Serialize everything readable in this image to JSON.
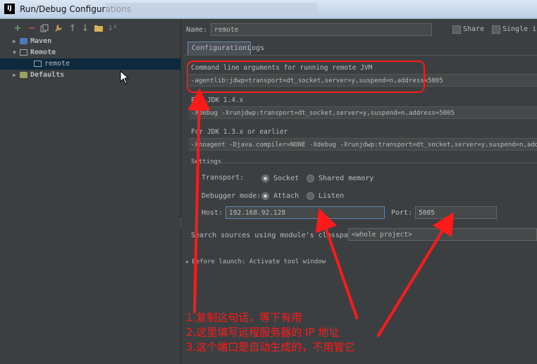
{
  "window": {
    "title": "Run/Debug Configurations",
    "app_icon_text": "IJ"
  },
  "tree": {
    "items": [
      {
        "label": "Maven",
        "expanded": false
      },
      {
        "label": "Remote",
        "expanded": true
      },
      {
        "label": "remote",
        "selected": true
      },
      {
        "label": "Defaults",
        "expanded": false
      }
    ]
  },
  "form": {
    "name_label": "Name:",
    "name_value": "remote",
    "share_label": "Share",
    "single_instance_label": "Single in",
    "tabs": [
      {
        "label": "Configuration",
        "active": true
      },
      {
        "label": "Logs",
        "active": false
      }
    ],
    "cmd_label": "Command line arguments for running remote JVM",
    "cmd_value": "-agentlib:jdwp=transport=dt_socket,server=y,suspend=n,address=5005",
    "jdk14_label": "For JDK 1.4.x",
    "jdk14_value": "-Xdebug -Xrunjdwp:transport=dt_socket,server=y,suspend=n,address=5005",
    "jdk13_label": "For JDK 1.3.x or earlier",
    "jdk13_value": "-Xnoagent -Djava.compiler=NONE -Xdebug -Xrunjdwp:transport=dt_socket,server=y,suspend=n,address=5005",
    "settings_label": "Settings",
    "transport_label": "Transport:",
    "transport_options": [
      {
        "label": "Socket",
        "selected": true
      },
      {
        "label": "Shared memory",
        "selected": false
      }
    ],
    "debugger_mode_label": "Debugger mode:",
    "debugger_mode_options": [
      {
        "label": "Attach",
        "selected": true
      },
      {
        "label": "Listen",
        "selected": false
      }
    ],
    "host_label": "Host:",
    "host_value": "192.168.92.128",
    "port_label": "Port:",
    "port_value": "5005",
    "search_sources_label": "Search sources using module's classpath:",
    "search_sources_value": "<whole project>",
    "before_launch_label": "Before launch: Activate tool window"
  },
  "annotations": [
    "1.复制这句话，等下有用",
    "2.这里填写远程服务器的 IP 地址",
    "3.这个端口是自动生成的，不用管它"
  ],
  "colors": {
    "annotation": "#ff1a1a",
    "background": "#3c3f41",
    "selection": "#0d293e"
  }
}
